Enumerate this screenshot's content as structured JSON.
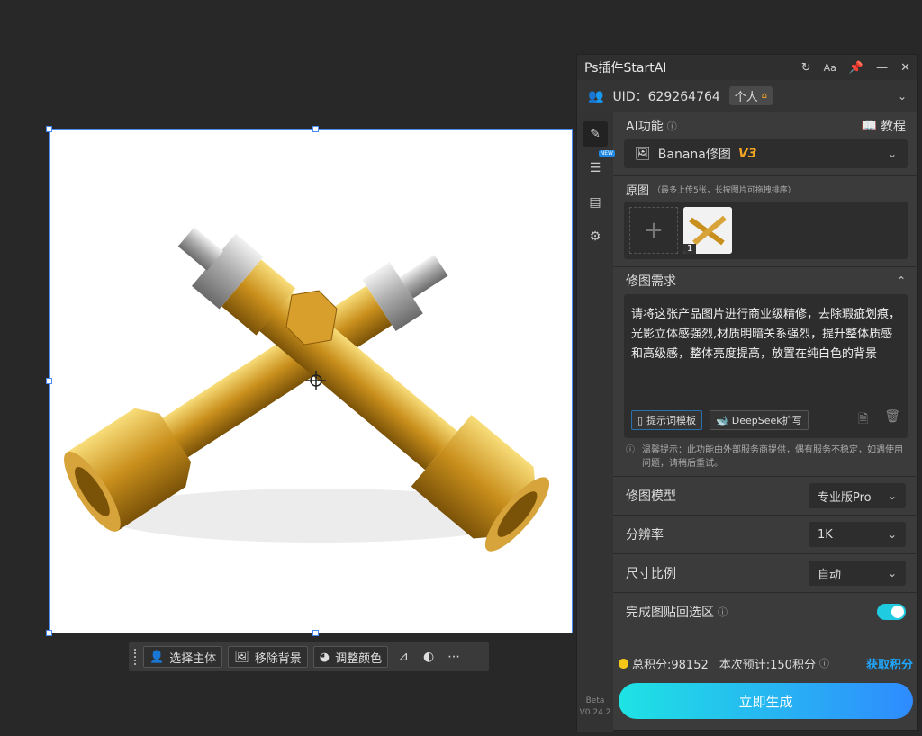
{
  "panel": {
    "title": "Ps插件StartAI",
    "uid": "UID：629264764",
    "account_type": "个人"
  },
  "ai_section": {
    "label": "AI功能",
    "tutorial": "教程",
    "feature": "Banana修图",
    "version_tag": "V3"
  },
  "original": {
    "label": "原图",
    "hint": "（最多上传5张，长按图片可拖拽排序）",
    "thumb_index": "1"
  },
  "requirement": {
    "label": "修图需求",
    "prompt": "请将这张产品图片进行商业级精修，去除瑕疵划痕，光影立体感强烈,材质明暗关系强烈，提升整体质感和高级感，整体亮度提高，放置在纯白色的背景",
    "template_btn": "提示词模板",
    "deepseek_btn": "DeepSeek扩写",
    "notice": "温馨提示：此功能由外部服务商提供，偶有服务不稳定，如遇使用问题，请稍后重试。"
  },
  "options": {
    "model_label": "修图模型",
    "model_value": "专业版Pro",
    "resolution_label": "分辨率",
    "resolution_value": "1K",
    "ratio_label": "尺寸比例",
    "ratio_value": "自动",
    "paste_label": "完成图贴回选区"
  },
  "footer": {
    "total_points": "总积分:98152",
    "estimate": "本次预计:150积分",
    "get_points": "获取积分",
    "generate": "立即生成",
    "beta": "Beta",
    "version": "V0.24.2"
  },
  "toolbar": {
    "select_subject": "选择主体",
    "remove_bg": "移除背景",
    "adjust_color": "调整颜色"
  },
  "colors": {
    "accent": "#1ea7fd",
    "gold": "#f5a623",
    "toggle": "#1ecbe1"
  }
}
